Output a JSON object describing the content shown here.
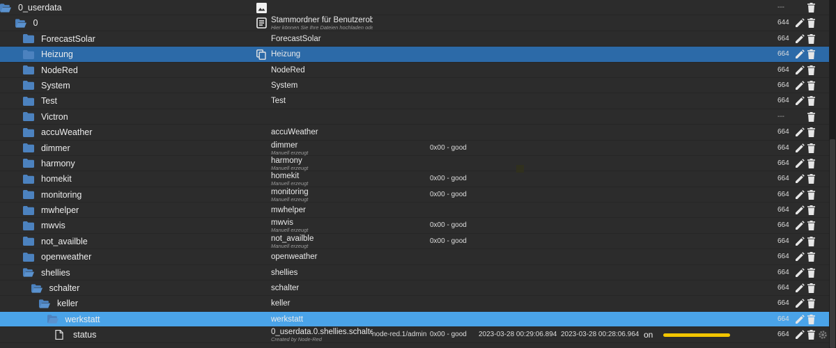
{
  "colors": {
    "background": "#2c2c2c",
    "selected_row": "#2c6aa8",
    "active_row": "#4aa3e8",
    "folder_icon": "#4c82bf",
    "value_bar": "#f2c500"
  },
  "rows": [
    {
      "name": "0_userdata",
      "indent": 0,
      "icon": "folder-open-icon",
      "type_icon": "image-icon",
      "title": "",
      "subtitle": "",
      "acl": "---",
      "edit": false,
      "state": ""
    },
    {
      "name": "0",
      "indent": 1,
      "icon": "folder-open-icon",
      "type_icon": "document-icon",
      "title": "Stammordner für Benutzerobjekte",
      "subtitle": "Hier können Sie Ihre Dateien hochladen oder Ihr",
      "acl": "644",
      "edit": true,
      "state": ""
    },
    {
      "name": "ForecastSolar",
      "indent": 2,
      "icon": "folder-icon",
      "type_icon": "",
      "title": "ForecastSolar",
      "subtitle": "",
      "acl": "664",
      "edit": true,
      "state": ""
    },
    {
      "name": "Heizung",
      "indent": 2,
      "icon": "folder-icon",
      "type_icon": "copy-icon",
      "title": "Heizung",
      "subtitle": "",
      "acl": "664",
      "edit": true,
      "state": "sel1"
    },
    {
      "name": "NodeRed",
      "indent": 2,
      "icon": "folder-icon",
      "type_icon": "",
      "title": "NodeRed",
      "subtitle": "",
      "acl": "664",
      "edit": true,
      "state": ""
    },
    {
      "name": "System",
      "indent": 2,
      "icon": "folder-icon",
      "type_icon": "",
      "title": "System",
      "subtitle": "",
      "acl": "664",
      "edit": true,
      "state": ""
    },
    {
      "name": "Test",
      "indent": 2,
      "icon": "folder-icon",
      "type_icon": "",
      "title": "Test",
      "subtitle": "",
      "acl": "664",
      "edit": true,
      "state": ""
    },
    {
      "name": "Victron",
      "indent": 2,
      "icon": "folder-icon",
      "type_icon": "",
      "title": "",
      "subtitle": "",
      "acl": "---",
      "edit": false,
      "state": ""
    },
    {
      "name": "accuWeather",
      "indent": 2,
      "icon": "folder-icon",
      "type_icon": "",
      "title": "accuWeather",
      "subtitle": "",
      "acl": "664",
      "edit": true,
      "state": ""
    },
    {
      "name": "dimmer",
      "indent": 2,
      "icon": "folder-icon",
      "type_icon": "",
      "title": "dimmer",
      "subtitle": "Manuell erzeugt",
      "status": "0x00 - good",
      "acl": "664",
      "edit": true,
      "state": ""
    },
    {
      "name": "harmony",
      "indent": 2,
      "icon": "folder-icon",
      "type_icon": "",
      "title": "harmony",
      "subtitle": "Manuell erzeugt",
      "acl": "664",
      "edit": true,
      "state": ""
    },
    {
      "name": "homekit",
      "indent": 2,
      "icon": "folder-icon",
      "type_icon": "",
      "title": "homekit",
      "subtitle": "Manuell erzeugt",
      "status": "0x00 - good",
      "acl": "664",
      "edit": true,
      "state": ""
    },
    {
      "name": "monitoring",
      "indent": 2,
      "icon": "folder-icon",
      "type_icon": "",
      "title": "monitoring",
      "subtitle": "Manuell erzeugt",
      "status": "0x00 - good",
      "acl": "664",
      "edit": true,
      "state": ""
    },
    {
      "name": "mwhelper",
      "indent": 2,
      "icon": "folder-icon",
      "type_icon": "",
      "title": "mwhelper",
      "subtitle": "",
      "acl": "664",
      "edit": true,
      "state": ""
    },
    {
      "name": "mwvis",
      "indent": 2,
      "icon": "folder-icon",
      "type_icon": "",
      "title": "mwvis",
      "subtitle": "Manuell erzeugt",
      "status": "0x00 - good",
      "acl": "664",
      "edit": true,
      "state": ""
    },
    {
      "name": "not_availble",
      "indent": 2,
      "icon": "folder-icon",
      "type_icon": "",
      "title": "not_availble",
      "subtitle": "Manuell erzeugt",
      "status": "0x00 - good",
      "acl": "664",
      "edit": true,
      "state": ""
    },
    {
      "name": "openweather",
      "indent": 2,
      "icon": "folder-icon",
      "type_icon": "",
      "title": "openweather",
      "subtitle": "",
      "acl": "664",
      "edit": true,
      "state": ""
    },
    {
      "name": "shellies",
      "indent": 2,
      "icon": "folder-open-icon",
      "type_icon": "",
      "title": "shellies",
      "subtitle": "",
      "acl": "664",
      "edit": true,
      "state": ""
    },
    {
      "name": "schalter",
      "indent": 3,
      "icon": "folder-open-icon",
      "type_icon": "",
      "title": "schalter",
      "subtitle": "",
      "acl": "664",
      "edit": true,
      "state": ""
    },
    {
      "name": "keller",
      "indent": 4,
      "icon": "folder-open-icon",
      "type_icon": "",
      "title": "keller",
      "subtitle": "",
      "acl": "664",
      "edit": true,
      "state": ""
    },
    {
      "name": "werkstatt",
      "indent": 5,
      "icon": "folder-open-icon",
      "type_icon": "",
      "title": "werkstatt",
      "subtitle": "",
      "acl": "664",
      "edit": true,
      "state": "sel2"
    },
    {
      "name": "status",
      "indent": 6,
      "icon": "file-icon",
      "type_icon": "",
      "title": "0_userdata.0.shellies.schalter.kelle",
      "subtitle": "Created by Node-Red",
      "role": "node-red.1/admin",
      "status": "0x00 - good",
      "ts": "2023-03-28 00:29:06.894",
      "lc": "2023-03-28 00:28:06.964",
      "value": "on",
      "value_level": 1,
      "acl": "664",
      "edit": true,
      "gear": true,
      "state": ""
    }
  ]
}
